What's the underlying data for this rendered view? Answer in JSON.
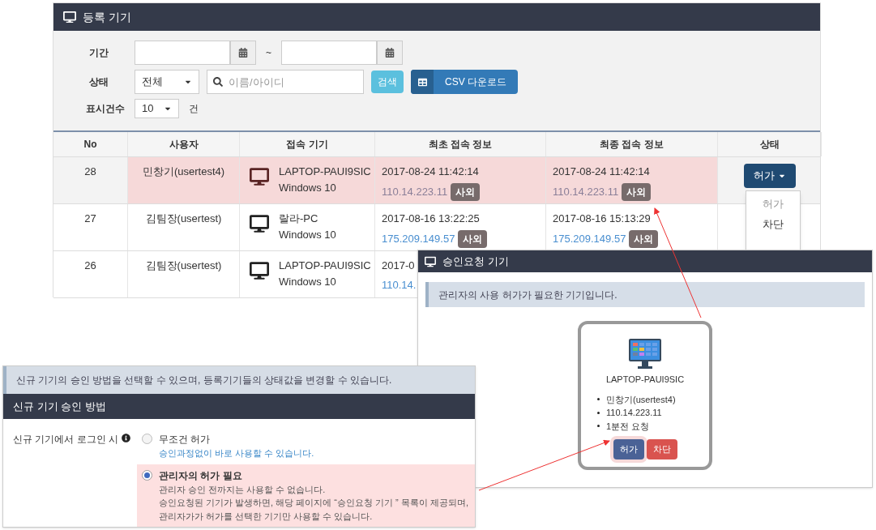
{
  "device_list": {
    "title": "등록 기기",
    "filters": {
      "period_label": "기간",
      "separator": "~",
      "status_label": "상태",
      "status_value": "전체",
      "search_placeholder": "이름/아이디",
      "search_button": "검색",
      "csv_button": "CSV 다운로드",
      "page_size_label": "표시건수",
      "page_size_value": "10",
      "page_size_unit": "건"
    },
    "table": {
      "columns": [
        "No",
        "사용자",
        "접속 기기",
        "최초 접속 정보",
        "최종 접속 정보",
        "상태"
      ],
      "rows": [
        {
          "no": "28",
          "user": "민창기(usertest4)",
          "device": "LAPTOP-PAUI9SIC",
          "os": "Windows 10",
          "first_time": "2017-08-24 11:42:14",
          "first_ip": "110.14.223.11",
          "first_tag": "사외",
          "last_time": "2017-08-24 11:42:14",
          "last_ip": "110.14.223.11",
          "last_tag": "사외",
          "highlighted": true,
          "status": "허가"
        },
        {
          "no": "27",
          "user": "김팀장(usertest)",
          "device": "랄라-PC",
          "os": "Windows 10",
          "first_time": "2017-08-16 13:22:25",
          "first_ip": "175.209.149.57",
          "first_tag": "사외",
          "last_time": "2017-08-16 15:13:29",
          "last_ip": "175.209.149.57",
          "last_tag": "사외",
          "highlighted": false
        },
        {
          "no": "26",
          "user": "김팀장(usertest)",
          "device": "LAPTOP-PAUI9SIC",
          "os": "Windows 10",
          "first_time": "2017-0",
          "first_ip": "110.14.",
          "highlighted": false
        }
      ]
    },
    "status_menu": [
      {
        "label": "허가",
        "selected": true
      },
      {
        "label": "차단",
        "selected": false
      }
    ]
  },
  "approval_popup": {
    "title": "승인요청 기기",
    "notice": "관리자의 사용 허가가 필요한 기기입니다.",
    "device": {
      "name": "LAPTOP-PAUI9SIC",
      "details": [
        "민창기(usertest4)",
        "110.14.223.11",
        "1분전 요청"
      ],
      "buttons": [
        {
          "label": "허가",
          "kind": "approve"
        },
        {
          "label": "차단",
          "kind": "block"
        }
      ]
    }
  },
  "approval_settings": {
    "notice": "신규 기기의 승인 방법을 선택할 수 있으며, 등록기기들의 상태값을 변경할 수 있습니다.",
    "title": "신규 기기 승인 방법",
    "field_label": "신규 기기에서 로그인 시",
    "options": [
      {
        "label": "무조건 허가",
        "description": [
          "승인과정없이 바로 사용할 수 있습니다."
        ],
        "selected": false
      },
      {
        "label": "관리자의 허가 필요",
        "description": [
          "관리자 승인 전까지는 사용할 수 없습니다.",
          "승인요청된 기기가 발생하면, 해당 페이지에 “승인요청 기기 ” 목록이 제공되며,",
          "관리자가가 허가를 선택한 기기만 사용할 수 있습니다."
        ],
        "selected": true
      }
    ]
  }
}
